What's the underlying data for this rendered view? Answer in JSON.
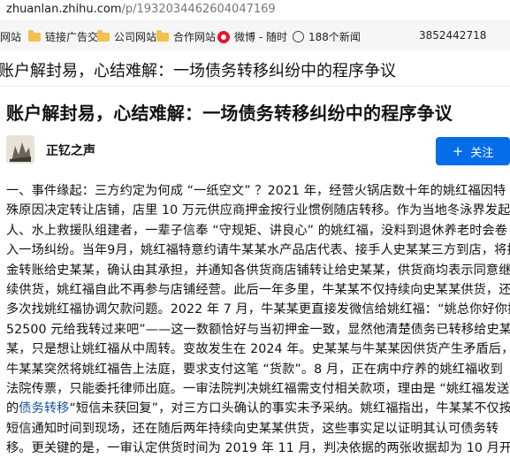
{
  "browser": {
    "url_host": "zhuanlan.zhihu.com",
    "url_path": "/p/1932034462604047169",
    "bookmarks": [
      {
        "label": "网站",
        "icon": "folder-icon"
      },
      {
        "label": "链接广告交",
        "icon": "folder-icon"
      },
      {
        "label": "公司网站",
        "icon": "folder-icon"
      },
      {
        "label": "合作网站",
        "icon": "folder-icon"
      },
      {
        "label": "微博 - 随时",
        "icon": "weibo-icon"
      },
      {
        "label": "188个新闻",
        "icon": "globe-icon"
      },
      {
        "label": "3852442718",
        "icon": ""
      }
    ]
  },
  "sticky_title": "账户解封易，心结难解：一场债务转移纠纷中的程序争议",
  "article": {
    "title": "账户解封易，心结难解：一场债务转移纠纷中的程序争议",
    "author": "正钇之声",
    "follow_label": "关注",
    "lines": [
      [
        {
          "t": "一、事件缘起：三方约定为何成 “一纸空文” ？2021 年，经营火锅店数十年的姚红福因特"
        }
      ],
      [
        {
          "t": "殊原因决定转让店铺，店里 10 万元供应商押金按行业惯例随店转移。作为当地冬泳界发起"
        }
      ],
      [
        {
          "t": "人、水上救援队组建者，一辈子信奉 “守规矩、讲良心” 的姚红福，没料到退休养老时会卷"
        }
      ],
      [
        {
          "t": "入一场纠纷。当年9月，姚红福特意约请牛某某水产品店代表、接手人史某某三方到店，将押"
        }
      ],
      [
        {
          "t": "金转账给史某某，确认由其承担，并通知各供货商店铺转让给史某某，供货商均表示同意继"
        }
      ],
      [
        {
          "t": "续供货，姚红福自此不再参与店铺经营。此后一年多里，牛某某不仅持续向史某某供货，还"
        }
      ],
      [
        {
          "t": "多次找姚红福协调欠款问题。2022 年 7 月，牛某某更直接发微信给姚红福：“姚总你好你把"
        }
      ],
      [
        {
          "t": "52500 元给我转过来吧”——这一数额恰好与当初押金一致，显然他清楚债务已转移给史某"
        }
      ],
      [
        {
          "t": "某，只是想让姚红福从中周转。变故发生在 2024 年。史某某与牛某某因供货产生矛盾后，"
        }
      ],
      [
        {
          "t": "牛某某突然将姚红福告上法庭，要求支付这笔 “货款”。8 月，正在病中疗养的姚红福收到"
        }
      ],
      [
        {
          "t": "法院传票，只能委托律师出庭。一审法院判决姚红福需支付相关款项，理由是 “姚红福发送"
        }
      ],
      [
        {
          "t": "的"
        },
        {
          "t": "债务转移",
          "link": true
        },
        {
          "t": "“短信未获回复”，对三方口头确认的事实未予采纳。姚红福指出，牛某某不仅按"
        }
      ],
      [
        {
          "t": "短信通知时间到现场，还在随后两年持续向史某某供货，这些事实足以证明其认可债务转"
        }
      ],
      [
        {
          "t": "移。更关键的是，一审认定供货时间为 2019 年 11 月，判决依据的两张收据却为 10 月开"
        }
      ]
    ]
  }
}
